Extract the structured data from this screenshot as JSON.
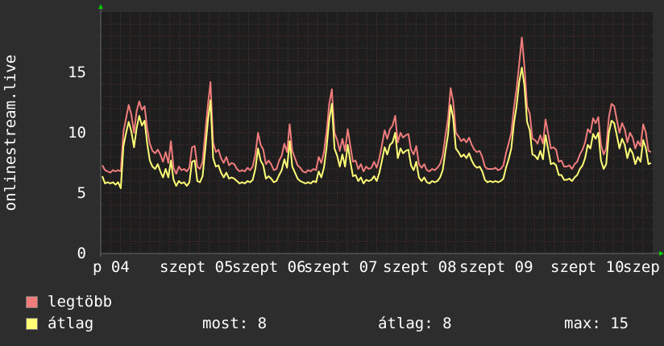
{
  "colors": {
    "background": "#2d2d2d",
    "plot_background": "#1e1e1e",
    "grid": "#5a3535",
    "axis": "#6b6b6b",
    "text": "#ffffff",
    "arrow": "#00cc00"
  },
  "chart_data": {
    "type": "line",
    "ylabel": "onlinestream.live",
    "ylim": [
      0,
      20
    ],
    "yticks": [
      0,
      5,
      10,
      15
    ],
    "x_tick_labels": [
      "p 04",
      "szept 05",
      "szept 06",
      "szept 07",
      "szept 08",
      "szept 09",
      "szept 10",
      "szep"
    ],
    "grid": true,
    "series": [
      {
        "name": "legtöbb",
        "color": "#f07c7c",
        "values": [
          7.3,
          6.9,
          6.8,
          6.7,
          6.9,
          6.8,
          6.9,
          6.8,
          10.1,
          11.2,
          12.3,
          11.5,
          10.0,
          11.8,
          12.6,
          11.9,
          12.2,
          10.3,
          9.1,
          8.5,
          8.3,
          8.6,
          8.2,
          7.6,
          8.4,
          7.5,
          9.3,
          7.1,
          6.6,
          7.2,
          6.9,
          7.0,
          6.8,
          7.1,
          8.8,
          8.9,
          7.2,
          7.0,
          7.6,
          10.0,
          12.3,
          14.2,
          9.2,
          8.4,
          8.6,
          7.9,
          7.5,
          8.0,
          7.3,
          7.5,
          7.4,
          7.0,
          6.8,
          6.9,
          6.8,
          7.1,
          6.9,
          7.2,
          8.2,
          10.0,
          9.0,
          8.6,
          7.4,
          7.7,
          7.4,
          6.9,
          7.0,
          7.7,
          8.1,
          9.1,
          8.4,
          10.7,
          8.5,
          7.9,
          7.3,
          7.1,
          6.8,
          6.7,
          6.9,
          6.8,
          7.0,
          6.9,
          8.0,
          7.5,
          8.4,
          10.1,
          12.4,
          13.6,
          10.0,
          9.4,
          8.5,
          9.5,
          8.5,
          10.3,
          8.9,
          7.6,
          7.7,
          7.0,
          7.4,
          6.8,
          7.2,
          7.0,
          7.1,
          7.6,
          7.1,
          7.9,
          9.0,
          10.2,
          9.5,
          10.3,
          10.6,
          11.4,
          9.2,
          10.0,
          9.6,
          9.8,
          9.9,
          8.6,
          8.2,
          8.9,
          7.4,
          7.1,
          7.4,
          6.9,
          6.8,
          7.0,
          6.9,
          7.1,
          7.4,
          8.1,
          9.7,
          11.1,
          13.7,
          12.6,
          10.0,
          9.7,
          9.3,
          9.5,
          9.2,
          9.6,
          9.0,
          8.6,
          8.4,
          8.5,
          8.0,
          7.2,
          7.0,
          7.0,
          7.0,
          7.1,
          6.9,
          7.0,
          7.3,
          8.3,
          9.1,
          10.0,
          12.1,
          13.6,
          15.7,
          17.9,
          15.5,
          12.2,
          11.6,
          9.5,
          9.4,
          9.1,
          9.8,
          9.1,
          11.1,
          9.9,
          8.7,
          8.8,
          8.6,
          7.6,
          7.7,
          7.2,
          7.2,
          7.3,
          7.0,
          7.4,
          7.6,
          8.2,
          8.6,
          9.2,
          10.3,
          10.0,
          11.2,
          10.8,
          11.3,
          9.0,
          8.2,
          8.7,
          11.3,
          12.4,
          12.2,
          11.1,
          10.0,
          10.8,
          10.3,
          9.2,
          10.0,
          9.6,
          8.7,
          9.3,
          8.9,
          10.7,
          10.0,
          8.5,
          8.4
        ]
      },
      {
        "name": "átlag",
        "color": "#ffff77",
        "values": [
          6.4,
          5.8,
          5.9,
          5.8,
          5.9,
          5.7,
          5.9,
          5.4,
          8.9,
          10.0,
          10.9,
          10.1,
          8.8,
          10.4,
          11.4,
          10.6,
          11.0,
          9.1,
          7.7,
          7.2,
          7.0,
          7.4,
          6.8,
          6.3,
          7.0,
          6.3,
          7.7,
          6.1,
          5.6,
          6.0,
          5.8,
          5.9,
          5.6,
          5.9,
          7.6,
          7.7,
          6.0,
          5.9,
          6.4,
          8.6,
          11.0,
          12.7,
          7.9,
          7.2,
          7.3,
          6.7,
          6.3,
          6.7,
          6.2,
          6.3,
          6.2,
          6.0,
          5.8,
          5.9,
          5.8,
          6.0,
          5.9,
          6.1,
          7.0,
          8.7,
          7.7,
          7.3,
          6.2,
          6.4,
          6.2,
          5.9,
          6.0,
          6.5,
          6.9,
          7.8,
          7.1,
          9.3,
          7.2,
          6.7,
          6.2,
          6.0,
          5.9,
          5.8,
          5.9,
          5.8,
          6.0,
          5.9,
          6.8,
          6.3,
          7.1,
          8.8,
          11.1,
          12.4,
          8.7,
          8.1,
          7.2,
          8.2,
          7.2,
          9.0,
          7.6,
          6.4,
          6.5,
          6.0,
          6.3,
          5.8,
          6.1,
          6.0,
          6.1,
          6.4,
          6.0,
          6.7,
          7.7,
          8.8,
          8.2,
          9.0,
          9.2,
          10.0,
          7.9,
          8.7,
          8.3,
          8.5,
          8.6,
          7.3,
          6.9,
          7.6,
          6.3,
          6.0,
          6.3,
          5.9,
          5.8,
          6.0,
          5.9,
          6.0,
          6.3,
          6.9,
          8.4,
          9.8,
          12.3,
          11.2,
          8.7,
          8.4,
          8.0,
          8.2,
          7.9,
          8.3,
          7.7,
          7.3,
          7.1,
          7.2,
          6.8,
          6.1,
          5.9,
          6.0,
          5.9,
          6.0,
          5.9,
          6.0,
          6.2,
          7.1,
          7.8,
          8.7,
          10.8,
          12.2,
          14.2,
          15.4,
          13.9,
          10.9,
          10.2,
          8.2,
          8.1,
          7.8,
          8.5,
          7.8,
          9.8,
          8.6,
          7.4,
          7.5,
          7.3,
          6.5,
          6.5,
          6.1,
          6.1,
          6.2,
          6.0,
          6.3,
          6.5,
          7.0,
          7.3,
          7.9,
          9.0,
          8.7,
          9.9,
          9.5,
          10.0,
          7.7,
          7.0,
          7.4,
          10.0,
          11.0,
          10.8,
          9.8,
          8.7,
          9.5,
          9.0,
          7.9,
          8.7,
          8.3,
          7.4,
          8.0,
          7.6,
          9.4,
          8.7,
          7.4,
          7.5
        ]
      }
    ]
  },
  "legend": {
    "items": [
      {
        "label": "legtöbb",
        "color": "#f07c7c"
      },
      {
        "label": "átlag",
        "color": "#ffff77"
      }
    ]
  },
  "stats": {
    "current": "most: 8",
    "average": "átlag: 8",
    "max": "max: 15"
  }
}
